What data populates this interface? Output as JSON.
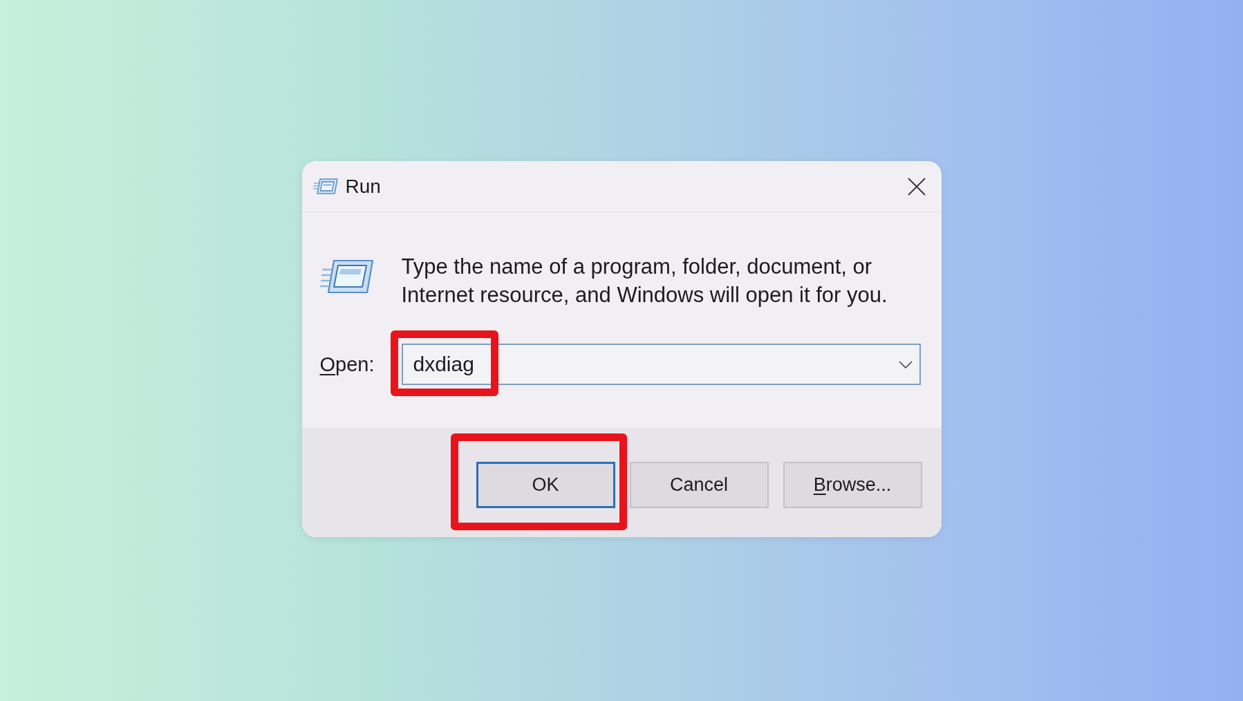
{
  "window": {
    "title": "Run"
  },
  "description": "Type the name of a program, folder, document, or Internet resource, and Windows will open it for you.",
  "open_field": {
    "label_parts": [
      {
        "text": "O",
        "underlined": true
      },
      {
        "text": "pen:",
        "underlined": false
      }
    ],
    "value": "dxdiag",
    "highlighted": true
  },
  "buttons": [
    {
      "label_parts": [
        {
          "text": "OK",
          "underlined": false
        }
      ],
      "default": true,
      "highlighted": true
    },
    {
      "label_parts": [
        {
          "text": "Cancel",
          "underlined": false
        }
      ],
      "default": false,
      "highlighted": false
    },
    {
      "label_parts": [
        {
          "text": "B",
          "underlined": true
        },
        {
          "text": "rowse...",
          "underlined": false
        }
      ],
      "default": false,
      "highlighted": false
    }
  ]
}
